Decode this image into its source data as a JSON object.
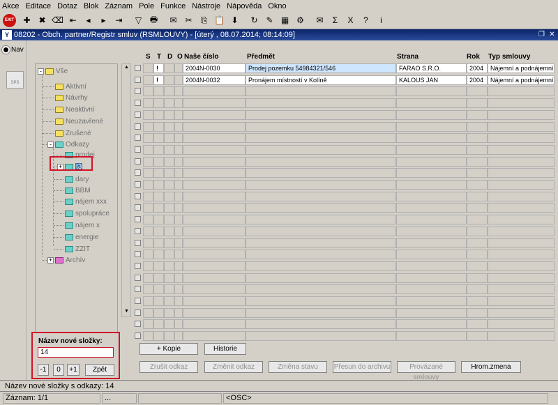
{
  "menu": [
    "Akce",
    "Editace",
    "Dotaz",
    "Blok",
    "Záznam",
    "Pole",
    "Funkce",
    "Nástroje",
    "Nápověda",
    "Okno"
  ],
  "toolbar": {
    "exit_label": "EXIT",
    "icons": [
      "new-record-icon",
      "delete-record-icon",
      "clear-record-icon",
      "first-record-icon",
      "prev-record-icon",
      "next-record-icon",
      "last-record-icon",
      "filter-icon",
      "print-icon",
      "mail-icon",
      "cut-icon",
      "copy-icon",
      "paste-icon",
      "fill-icon",
      "refresh-icon",
      "edit-icon",
      "calculator-icon",
      "settings-icon",
      "mail-open-icon",
      "sum-icon",
      "excel-icon",
      "help-icon",
      "about-icon"
    ],
    "glyphs": [
      "✚",
      "✖",
      "⌫",
      "⇤",
      "◂",
      "▸",
      "⇥",
      "▽",
      "🖶",
      "✉",
      "✂",
      "⎘",
      "📋",
      "⬇",
      "↻",
      "✎",
      "▦",
      "⚙",
      "✉",
      "Σ",
      "X",
      "?",
      "i"
    ]
  },
  "window": {
    "app_icon": "Y",
    "title": "08202 - Obch. partner/Registr smluv (RSMLOUVY) - [úterý , 08.07.2014; 08:14:09]"
  },
  "nav": {
    "label": "Nav",
    "sps": "SPS"
  },
  "tree": {
    "root": "Vše",
    "items": [
      "Aktivní",
      "Návrhy",
      "Neaktivní",
      "Neuzavřené",
      "Zrušené"
    ],
    "odkazy": "Odkazy",
    "odkazy_children": [
      "prodej",
      "t3",
      "dary",
      "BBM",
      "nájem xxx",
      "spolupráce",
      "nájem x",
      "energie",
      "ZZIT"
    ],
    "archiv": "Archív"
  },
  "grid": {
    "headers": {
      "s": "S",
      "t": "T",
      "d": "D",
      "o": "O",
      "nase_cislo": "Naše číslo",
      "predmet": "Předmět",
      "strana": "Strana",
      "rok": "Rok",
      "typ": "Typ smlouvy"
    },
    "rows": [
      {
        "t": "!",
        "nase_cislo": "2004N-0030",
        "predmet": "Prodej pozemku 54984321/546",
        "strana": "FARAO S.R.O.",
        "rok": "2004",
        "typ": "Nájemní a podnájemní"
      },
      {
        "t": "!",
        "nase_cislo": "2004N-0032",
        "predmet": "Pronájem místností v Kolíně",
        "strana": "KALOUS JAN",
        "rok": "2004",
        "typ": "Nájemní a podnájemní"
      }
    ]
  },
  "new_folder": {
    "label": "Název nové složky:",
    "value": "14",
    "btn_minus": "-1",
    "btn_zero": "0",
    "btn_plus": "+1",
    "btn_back": "Zpět"
  },
  "buttons": {
    "kopie": "+ Kopie",
    "historie": "Historie",
    "zrusit_odkaz": "Zrušit odkaz",
    "zmenit_odkaz": "Změnit odkaz",
    "zmena_stavu": "Změna stavu",
    "presun": "Přesun do archivu",
    "provazane": "Provázané smlouvy",
    "hrom": "Hrom.zmena"
  },
  "status": {
    "message": "Název nové složky s odkazy: 14",
    "record": "Záznam: 1/1",
    "dots": "...",
    "osc": "<OSC>"
  }
}
